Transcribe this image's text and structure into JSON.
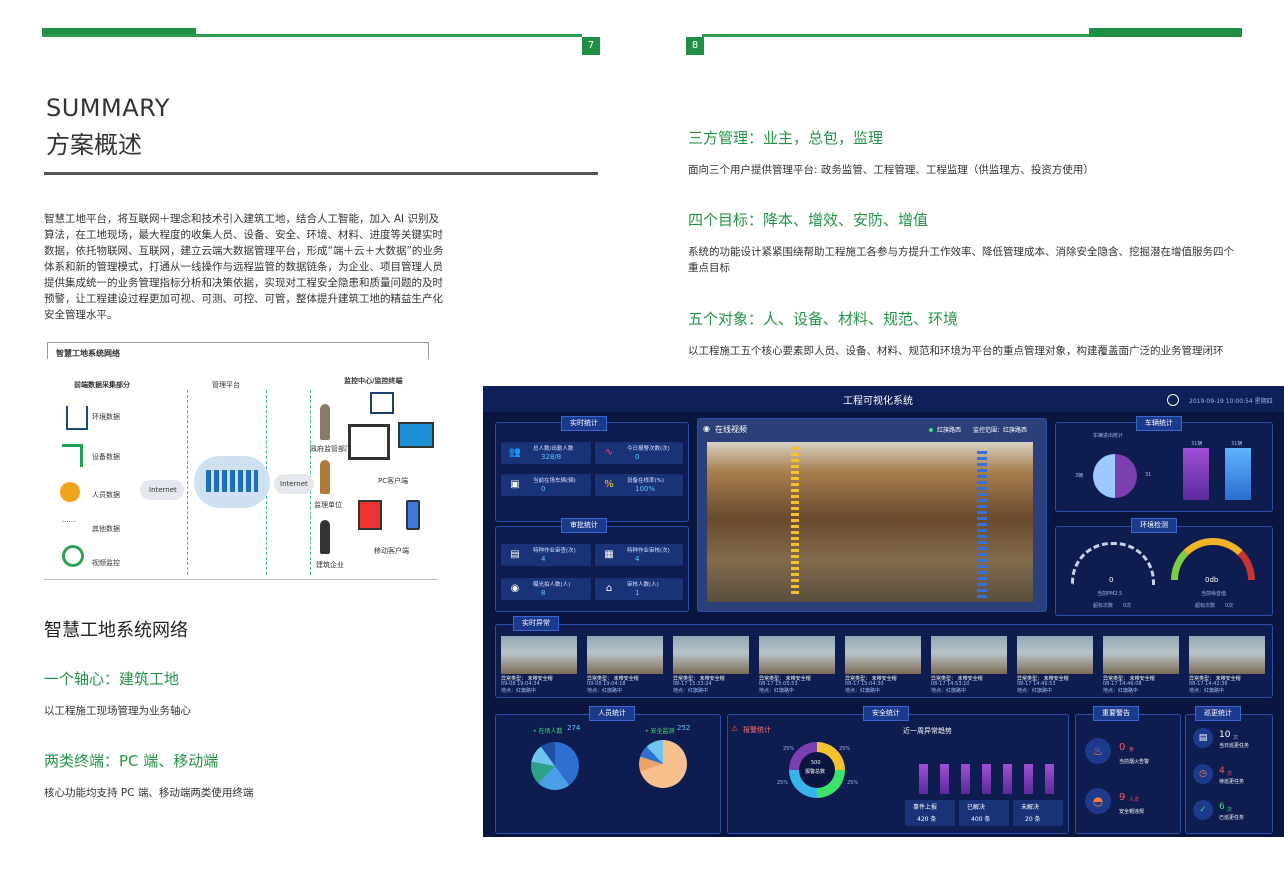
{
  "left_page": {
    "page_number": "7",
    "summary_en": "SUMMARY",
    "summary_cn": "方案概述",
    "intro": "智慧工地平台，将互联网＋理念和技术引入建筑工地，结合人工智能，加入 AI 识别及算法，在工地现场，最大程度的收集人员、设备、安全、环境、材料、进度等关键实时数据，依托物联网、互联网，建立云端大数据管理平台，形成“端＋云＋大数据”的业务体系和新的管理模式，打通从一线操作与远程监管的数据链条，为企业、项目管理人员提供集成统一的业务管理指标分析和决策依据，实现对工程安全隐患和质量问题的及时预警，让工程建设过程更加可视、可测、可控、可管，整体提升建筑工地的精益生产化安全管理水平。",
    "diagram": {
      "title": "智慧工地系统网络",
      "col_headers": [
        "前端数据采集部分",
        "管理平台",
        "监控中心/监控终端"
      ],
      "sources": [
        "环境数据",
        "设备数据",
        "人员数据",
        "其他数据",
        "视频监控"
      ],
      "dots": "......",
      "internet_left": "Internet",
      "internet_right": "Internet",
      "clients": [
        "政府监管部门",
        "监理单位",
        "建筑企业"
      ],
      "terminals": [
        "PC客户端",
        "移动客户端"
      ]
    },
    "network_heading": "智慧工地系统网络",
    "sections": [
      {
        "title": "一个轴心：建筑工地",
        "text": "以工程施工现场管理为业务轴心"
      },
      {
        "title": "两类终端：PC 端、移动端",
        "text": "核心功能均支持 PC 端、移动端两类使用终端"
      }
    ]
  },
  "right_page": {
    "page_number": "8",
    "sections": [
      {
        "title": "三方管理：业主，总包，监理",
        "text": "面向三个用户提供管理平台: 政务监管、工程管理、工程监理（供监理方、投资方使用）"
      },
      {
        "title": "四个目标：降本、增效、安防、增值",
        "text": "系统的功能设计紧紧围绕帮助工程施工各参与方提升工作效率、降低管理成本、消除安全隐含、挖掘潜在增值服务四个重点目标"
      },
      {
        "title": "五个对象：人、设备、材料、规范、环境",
        "text": "以工程施工五个核心要素即人员、设备、材料、规范和环境为平台的重点管理对象，构建覆盖面广泛的业务管理闭环"
      }
    ]
  },
  "dashboard": {
    "title": "工程可视化系统",
    "datetime": "2019-09-19 10:00:54 星期四",
    "realtime": {
      "label": "实时统计",
      "tiles": [
        {
          "icon": "people-icon",
          "label": "总人数/出勤人数",
          "value": "328/8"
        },
        {
          "icon": "pulse-icon",
          "label": "今日报警次数(次)",
          "value": "0"
        },
        {
          "icon": "vehicle-icon",
          "label": "当前在场车辆(辆)",
          "value": "0"
        },
        {
          "icon": "percent-icon",
          "label": "设备在线率(%)",
          "value": "100%"
        }
      ]
    },
    "audit": {
      "label": "审批统计",
      "tiles": [
        {
          "icon": "form-icon",
          "label": "特种作业审查(次)",
          "value": "4"
        },
        {
          "icon": "doc-icon",
          "label": "特种作业审核(次)",
          "value": "4"
        },
        {
          "icon": "camera-icon",
          "label": "曝光拍人数(人)",
          "value": "8"
        },
        {
          "icon": "home-icon",
          "label": "审核人数(人)",
          "value": "1"
        }
      ]
    },
    "video": {
      "label": "在线视频",
      "status": "红旗路西",
      "range_label": "监控范围：红旗路西"
    },
    "vehicle": {
      "label": "车辆统计",
      "pie_label": "车辆进出统计",
      "slice_a": "3辆",
      "slice_b": "31",
      "bar_a": "31辆",
      "bar_b": "31辆"
    },
    "environment": {
      "label": "环境检测",
      "gauges": [
        {
          "value": "0",
          "name": "当前PM2.5",
          "exceed": "超标次数",
          "exceed_val": "0次"
        },
        {
          "value": "0db",
          "name": "当前噪音值",
          "exceed": "超标次数",
          "exceed_val": "0次"
        }
      ]
    },
    "anomaly": {
      "label": "实时异常",
      "line1": "异常类型： 未带安全帽",
      "items": [
        {
          "time": "09-08 19:04:34",
          "loc": "地点：红旗路中"
        },
        {
          "time": "09-08 19:04:18",
          "loc": "地点：红旗路中"
        },
        {
          "time": "08-17 15:33:24",
          "loc": "地点：红旗路中"
        },
        {
          "time": "08-17 15:05:53",
          "loc": "地点：红旗路中"
        },
        {
          "time": "08-17 15:04:30",
          "loc": "地点：红旗路中"
        },
        {
          "time": "08-17 14:53:10",
          "loc": "地点：红旗路中"
        },
        {
          "time": "08-17 14:49:53",
          "loc": "地点：红旗路中"
        },
        {
          "time": "08-17 14:46:08",
          "loc": "地点：红旗路中"
        },
        {
          "time": "08-17 14:42:36",
          "loc": "地点：红旗路中"
        }
      ]
    },
    "personnel": {
      "label": "人员统计",
      "in_site": "• 在场人数",
      "in_site_val": "274",
      "safety": "• 安全监测",
      "safety_val": "252"
    },
    "safety": {
      "label": "安全统计",
      "alarm_label": "报警统计",
      "donut_center_val": "500",
      "donut_center_lbl": "报警总数",
      "pct": [
        "25%",
        "25%",
        "25%",
        "25%"
      ],
      "trend_title": "近一周异常趋势",
      "counts": [
        {
          "name": "事件上报",
          "value": "420 条"
        },
        {
          "name": "已解决",
          "value": "400 条"
        },
        {
          "name": "未解决",
          "value": "20 条"
        }
      ]
    },
    "warning": {
      "label": "重要警告",
      "items": [
        {
          "value": "0",
          "unit": "条",
          "name": "当前烟火告警"
        },
        {
          "value": "9",
          "unit": "人次",
          "name": "安全帽违规"
        }
      ]
    },
    "patrol": {
      "label": "巡更统计",
      "items": [
        {
          "value": "10",
          "unit": "次",
          "name": "当日巡更任务"
        },
        {
          "value": "4",
          "unit": "次",
          "name": "待巡更任务"
        },
        {
          "value": "6",
          "unit": "次",
          "name": "已巡更任务"
        }
      ]
    },
    "colors": {
      "accent_green": "#239447",
      "dash_bg": "#0b1640",
      "purple": "#7c3fb0",
      "cyan": "#35b6e8"
    }
  }
}
